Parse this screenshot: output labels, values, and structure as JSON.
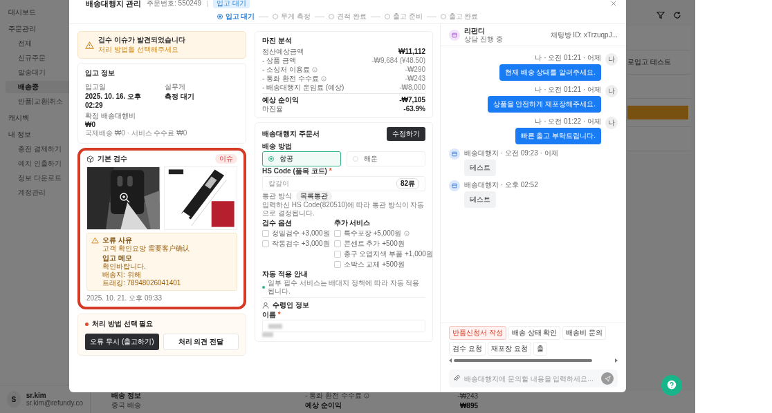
{
  "background": {
    "sidebar": {
      "items": [
        {
          "label": "대시보드",
          "selected": false
        },
        {
          "label": "주문관리",
          "selected": false,
          "children": [
            {
              "label": "전체",
              "selected": false
            },
            {
              "label": "신규주문",
              "selected": false
            },
            {
              "label": "발송대기",
              "selected": false
            },
            {
              "label": "배송중",
              "selected": true
            },
            {
              "label": "반품|교환|취소",
              "selected": false
            }
          ]
        },
        {
          "label": "캐시백",
          "selected": false
        },
        {
          "label": "내 정보",
          "selected": false,
          "children": [
            {
              "label": "충전 결제하기",
              "selected": false
            },
            {
              "label": "예치 인출하기",
              "selected": false
            },
            {
              "label": "정보 다운로드",
              "selected": false
            },
            {
              "label": "계정관리",
              "selected": false
            }
          ]
        }
      ]
    },
    "user": {
      "initial": "S",
      "name": "sr.kim",
      "email": "sr.kim@refundy.co"
    },
    "table_fragment": "로입고 테스트",
    "bottom": {
      "section_title": "배송 정보",
      "route": "중국 배송",
      "fee_label": "- 통화 환전 수수료",
      "fee_info": true,
      "fee_value": "-₩243",
      "profit_label": "예상 순이익",
      "profit_value": "₩895"
    }
  },
  "modal": {
    "title": "배송대행지 관리",
    "order_number": "주문번호: 550249",
    "status_badge": "입고 대기"
  },
  "steps": [
    {
      "label": "입고 대기",
      "selected": true
    },
    {
      "label": "무게 측정",
      "selected": false
    },
    {
      "label": "견적 완료",
      "selected": false
    },
    {
      "label": "출고 준비",
      "selected": false
    },
    {
      "label": "출고 완료",
      "selected": false
    }
  ],
  "alert": {
    "title": "검수 이슈가 발견되었습니다",
    "message": "처리 방법을 선택해주세요"
  },
  "receiving_info": {
    "title": "입고 정보",
    "fields": [
      {
        "label": "입고일",
        "value": "2025. 10. 16. 오후 02:29"
      },
      {
        "label": "실무게",
        "value": "측정 대기"
      },
      {
        "label": "확정 배송대행비",
        "value": "₩0"
      }
    ],
    "note": "국제배송 ₩0 · 서비스 수수료 ₩0"
  },
  "inspection": {
    "title": "기본 검수",
    "badge": "이슈",
    "error_label": "오류 사유",
    "error_text": "고객 확인요망 需要客户确认",
    "memo_label": "입고 메모",
    "memo_lines": [
      "확인바랍니다.",
      "배송지: 위해",
      "트래킹: 78948026041401"
    ],
    "timestamp": "2025. 10. 21. 오후 09:33"
  },
  "action": {
    "title": "처리 방법 선택 필요",
    "buttons": [
      {
        "label": "오류 무시 (출고하기)",
        "kind": "primary"
      },
      {
        "label": "처리 의견 전달",
        "kind": "secondary"
      }
    ]
  },
  "margin": {
    "title": "마진 분석",
    "rows": [
      {
        "label": "정산예상금액",
        "value": "₩11,112",
        "kind": "total",
        "info": false
      },
      {
        "label": "- 상품 금액",
        "value": "-₩9,684 (¥48.50)",
        "kind": "deduction",
        "info": false
      },
      {
        "label": "- 소싱처 이용료",
        "value": "-₩290",
        "kind": "deduction",
        "info": true
      },
      {
        "label": "- 통화 환전 수수료",
        "value": "-₩243",
        "kind": "deduction",
        "info": true
      },
      {
        "label": "- 배송대행지 운임료 (예상)",
        "value": "-₩8,000",
        "kind": "deduction",
        "info": false
      },
      {
        "label": "예상 순이익",
        "value": "-₩7,105",
        "kind": "result",
        "info": false
      },
      {
        "label": "마진율",
        "value": "-63.9%",
        "kind": "rate",
        "info": false
      }
    ]
  },
  "order_form": {
    "title": "배송대행지 주문서",
    "edit_button": "수정하기",
    "shipping_label": "배송 방법",
    "shipping_options": [
      {
        "label": "항공",
        "selected": true
      },
      {
        "label": "해운",
        "selected": false
      }
    ],
    "hs_label": "HS Code (품목 코드)",
    "hs_required_mark": "*",
    "hs_value": "칼갈이",
    "hs_badge": "82류",
    "tariff_label": "통관 방식",
    "tariff_value": "목록통관",
    "hs_note": "입력하신 HS Code(820510)에 따라 통관 방식이 자동으로 결정됩니다.",
    "inspection_options": {
      "title": "검수 옵션",
      "items": [
        {
          "label": "정밀검수 +3,000원",
          "checked": false,
          "info": false
        },
        {
          "label": "작동검수 +3,000원",
          "checked": false,
          "info": false
        }
      ]
    },
    "extra_services": {
      "title": "추가 서비스",
      "items": [
        {
          "label": "특수포장 +5,000원",
          "checked": false,
          "info": true
        },
        {
          "label": "콘센트 추가 +500원",
          "checked": false,
          "info": false
        },
        {
          "label": "충구 오염지색 부품 +1,000원",
          "checked": false,
          "info": false
        },
        {
          "label": "소박스 교체 +500원",
          "checked": false,
          "info": false
        }
      ]
    },
    "auto_title": "자동 적용 안내",
    "auto_note": "일부 필수 서비스는 배대지 정책에 따라 자동 적용됩니다."
  },
  "recipient": {
    "title": "수령인 정보",
    "name_label": "이름",
    "name_required_mark": "*"
  },
  "chat": {
    "title": "리펀디",
    "subtitle": "상담 진행 중",
    "session": "채팅방 ID: xTrzuqpJ...",
    "messages": [
      {
        "kind": "me",
        "avatar_label": "나",
        "meta": "나 · 오전 01:21 · 어제",
        "text": "현재 배송 상태를 알려주세요."
      },
      {
        "kind": "me",
        "avatar_label": "나",
        "meta": "나 · 오전 01:21 · 어제",
        "text": "상품을 안전하게 재포장해주세요."
      },
      {
        "kind": "me",
        "avatar_label": "나",
        "meta": "나 · 오전 01:22 · 어제",
        "text": "빠른 출고 부탁드립니다."
      },
      {
        "kind": "agent",
        "meta": "배송대행지 · 오전 09:23 · 어제",
        "text": "테스트"
      },
      {
        "kind": "agent",
        "meta": "배송대행지 · 오후 02:52",
        "text": "테스트"
      }
    ],
    "quick_replies": [
      {
        "label": "반품신청서 작성",
        "highlighted": true
      },
      {
        "label": "배송 상태 확인",
        "highlighted": false
      },
      {
        "label": "배송비 문의",
        "highlighted": false
      },
      {
        "label": "검수 요청",
        "highlighted": false
      },
      {
        "label": "재포장 요청",
        "highlighted": false
      },
      {
        "label": "출",
        "highlighted": false
      }
    ],
    "input_placeholder": "배송대행지에 문의할 내용을 입력하세요..."
  }
}
